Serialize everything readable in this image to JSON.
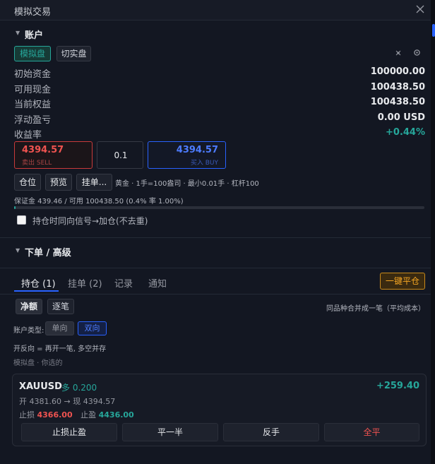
{
  "window": {
    "title": "模拟交易"
  },
  "account": {
    "section_title": "账户",
    "modes": [
      "模拟盘",
      "切实盘"
    ],
    "rows": [
      {
        "label": "初始资金",
        "value": "100000.00"
      },
      {
        "label": "可用现金",
        "value": "100438.50"
      },
      {
        "label": "当前权益",
        "value": "100438.50"
      },
      {
        "label": "浮动盈亏",
        "value": "0.00 USD"
      },
      {
        "label": "收益率",
        "value": "+0.44%"
      }
    ],
    "icons": {
      "pin": "pin-icon",
      "settings": "gear-icon"
    }
  },
  "quote": {
    "sell_price": "4394.57",
    "sell_label": "卖出 SELL",
    "quantity": "0.1",
    "buy_price": "4394.57",
    "buy_label": "买入 BUY"
  },
  "actions": {
    "position": "仓位",
    "preview": "预览",
    "pending": "挂单...",
    "info": "黄金 · 1手=100盎司 · 最小0.01手 · 杠杆100"
  },
  "margin": {
    "text": "保证金 439.46 / 可用 100438.50 (0.4% 率 1.00%)",
    "usage_percent": 0.4
  },
  "option": {
    "same_direction_add": "持仓时同向信号→加仓(不去重)"
  },
  "order": {
    "section_title": "下单 / 高级"
  },
  "tabs": [
    "持仓 (1)",
    "挂单 (2)",
    "记录",
    "通知"
  ],
  "close_all_button": "一键平仓",
  "view_modes": [
    "净额",
    "逐笔"
  ],
  "merge_note": "同品种合并成一笔（平均成本）",
  "account_type": {
    "label": "账户类型:",
    "options": [
      "单向",
      "双向"
    ]
  },
  "hedge_note": "开反向 = 再开一笔, 多空并存",
  "source_note": "模拟盘 · 你选的",
  "position": {
    "symbol": "XAUUSD",
    "side_qty": "多 0.200",
    "pnl": "+259.40",
    "open_label": "开",
    "open_price": "4381.60",
    "arrow": "→",
    "now_label": "现",
    "now_price": "4394.57",
    "sl_label": "止损",
    "sl_value": "4366.00",
    "tp_label": "止盈",
    "tp_value": "4436.00",
    "buttons": [
      "止损止盈",
      "平一半",
      "反手",
      "全平"
    ]
  },
  "colors": {
    "up": "#26a69a",
    "down": "#ef5350",
    "accent": "#2962ff",
    "warning": "#f5a623"
  }
}
